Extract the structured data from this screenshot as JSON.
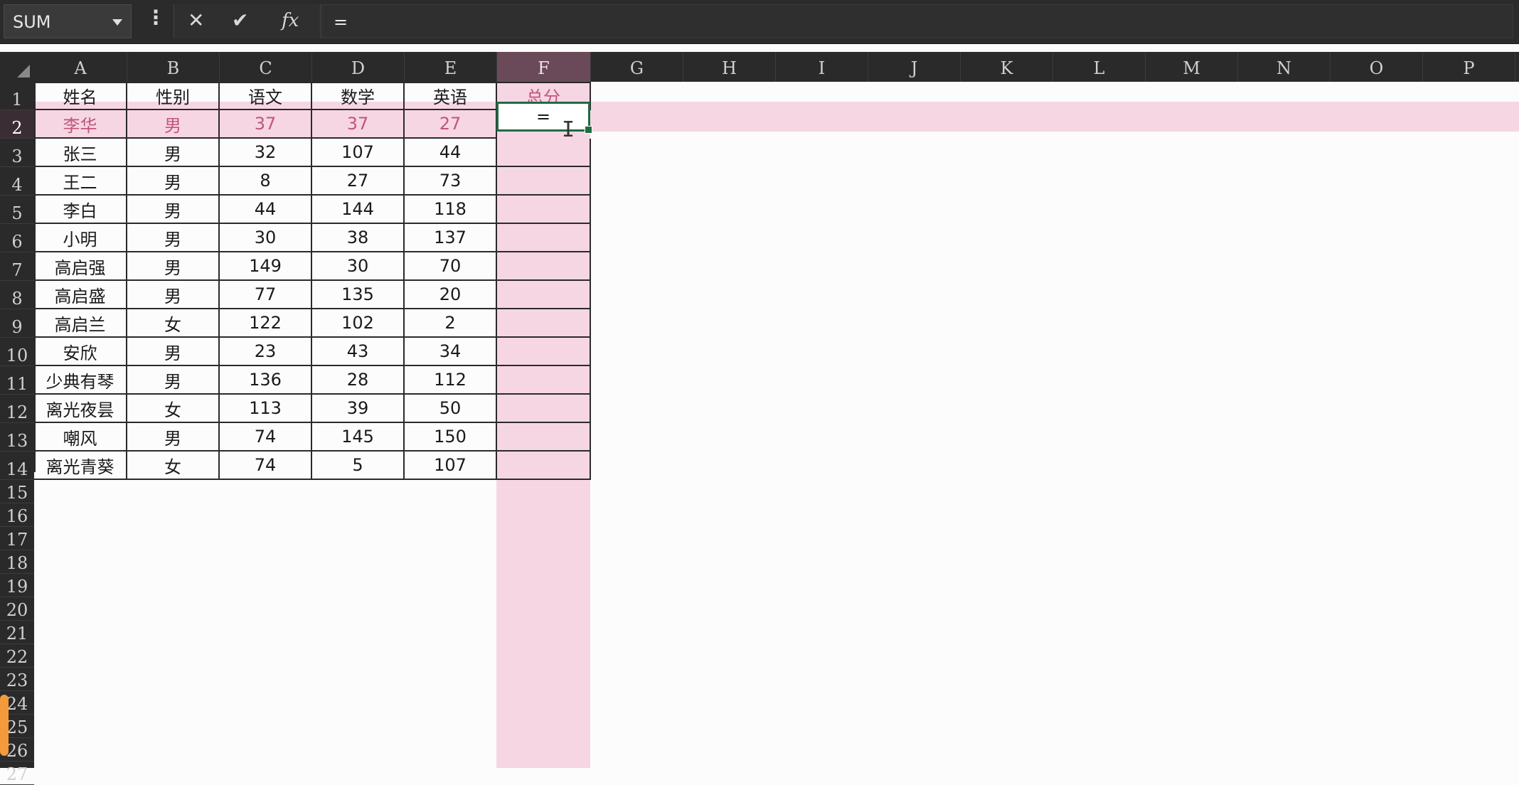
{
  "formula_bar": {
    "name_box": "SUM",
    "more_glyph": "⋮",
    "cancel_glyph": "✕",
    "enter_glyph": "✔",
    "fx_label": "fx",
    "formula": "="
  },
  "columns": [
    "A",
    "B",
    "C",
    "D",
    "E",
    "F",
    "G",
    "H",
    "I",
    "J",
    "K",
    "L",
    "M",
    "N",
    "O",
    "P"
  ],
  "rows": [
    "1",
    "2",
    "3",
    "4",
    "5",
    "6",
    "7",
    "8",
    "9",
    "10",
    "11",
    "12",
    "13",
    "14",
    "15",
    "16",
    "17",
    "18",
    "19",
    "20",
    "21",
    "22",
    "23",
    "24",
    "25",
    "26",
    "27"
  ],
  "table": {
    "headers": [
      "姓名",
      "性别",
      "语文",
      "数学",
      "英语",
      "总分"
    ],
    "data": [
      [
        "李华",
        "男",
        "37",
        "37",
        "27"
      ],
      [
        "张三",
        "男",
        "32",
        "107",
        "44"
      ],
      [
        "王二",
        "男",
        "8",
        "27",
        "73"
      ],
      [
        "李白",
        "男",
        "44",
        "144",
        "118"
      ],
      [
        "小明",
        "男",
        "30",
        "38",
        "137"
      ],
      [
        "高启强",
        "男",
        "149",
        "30",
        "70"
      ],
      [
        "高启盛",
        "男",
        "77",
        "135",
        "20"
      ],
      [
        "高启兰",
        "女",
        "122",
        "102",
        "2"
      ],
      [
        "安欣",
        "男",
        "23",
        "43",
        "34"
      ],
      [
        "少典有琴",
        "男",
        "136",
        "28",
        "112"
      ],
      [
        "离光夜昙",
        "女",
        "113",
        "39",
        "50"
      ],
      [
        "嘲风",
        "男",
        "74",
        "145",
        "150"
      ],
      [
        "离光青葵",
        "女",
        "74",
        "5",
        "107"
      ]
    ]
  },
  "active_cell": {
    "ref": "F2",
    "value": "="
  },
  "icons": {
    "ibeam": "I",
    "dropdown": "chevron-down-icon"
  },
  "colors": {
    "highlight": "#f7d6e3",
    "active_border": "#1f6b45",
    "chrome": "#2b2b2b"
  }
}
